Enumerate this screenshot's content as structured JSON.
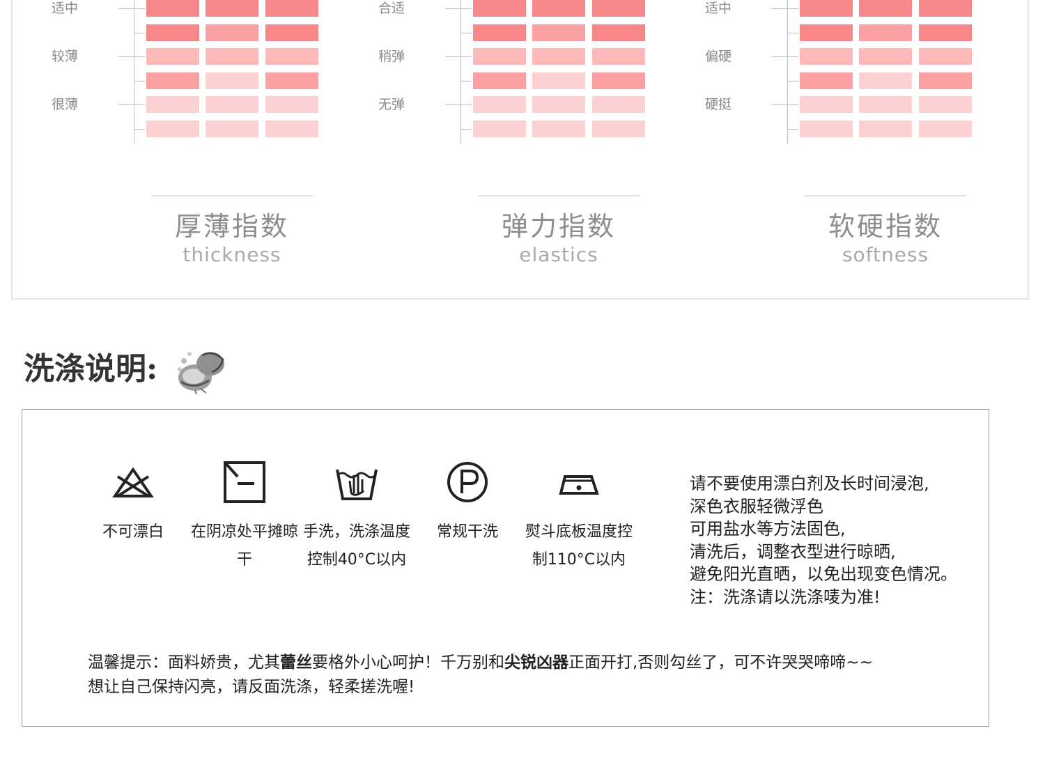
{
  "colors": {
    "level_strong": "#f88789",
    "level_mid": "#fba1a3",
    "level_light": "#fdb9ba",
    "level_pale": "#fdd1d2",
    "axis": "#bdbdbd"
  },
  "gauges": [
    {
      "title_cn": "厚薄指数",
      "title_en": "thickness",
      "labels": [
        "适中",
        "较薄",
        "很薄"
      ],
      "rows": [
        [
          "strong",
          "strong",
          "strong"
        ],
        [
          "strong",
          "mid",
          "strong"
        ],
        [
          "light",
          "light",
          "light"
        ],
        [
          "mid",
          "pale",
          "mid"
        ],
        [
          "pale",
          "pale",
          "pale"
        ],
        [
          "pale",
          "pale",
          "pale"
        ]
      ]
    },
    {
      "title_cn": "弹力指数",
      "title_en": "elastics",
      "labels": [
        "合适",
        "稍弹",
        "无弹"
      ],
      "rows": [
        [
          "strong",
          "strong",
          "strong"
        ],
        [
          "strong",
          "mid",
          "strong"
        ],
        [
          "light",
          "light",
          "light"
        ],
        [
          "mid",
          "pale",
          "mid"
        ],
        [
          "pale",
          "pale",
          "pale"
        ],
        [
          "pale",
          "pale",
          "pale"
        ]
      ]
    },
    {
      "title_cn": "软硬指数",
      "title_en": "softness",
      "labels": [
        "适中",
        "偏硬",
        "硬挺"
      ],
      "rows": [
        [
          "strong",
          "strong",
          "strong"
        ],
        [
          "strong",
          "mid",
          "strong"
        ],
        [
          "light",
          "light",
          "light"
        ],
        [
          "mid",
          "pale",
          "mid"
        ],
        [
          "pale",
          "pale",
          "pale"
        ],
        [
          "pale",
          "pale",
          "pale"
        ]
      ]
    }
  ],
  "wash": {
    "heading": "洗涤说明:",
    "icon": "washing-hands-icon",
    "care_items": [
      {
        "icon": "no-bleach-icon",
        "label": "不可漂白"
      },
      {
        "icon": "dry-flat-shade-icon",
        "label": "在阴凉处平摊晾干"
      },
      {
        "icon": "hand-wash-icon",
        "label": "手洗，洗涤温度控制40°C以内"
      },
      {
        "icon": "dry-clean-p-icon",
        "label": "常规干洗"
      },
      {
        "icon": "iron-icon",
        "label": "熨斗底板温度控制110°C以内"
      }
    ],
    "notes": [
      "请不要使用漂白剂及长时间浸泡,",
      "深色衣服轻微浮色",
      "可用盐水等方法固色,",
      "清洗后，调整衣型进行晾晒,",
      "避免阳光直晒，以免出现变色情况。",
      "注：洗涤请以洗涤唛为准!"
    ],
    "tips": {
      "line1_a": "温馨提示：面料娇贵，尤其",
      "line1_b": "蕾丝",
      "line1_c": "要格外小心呵护！千万别和",
      "line1_d": "尖锐凶器",
      "line1_e": "正面开打,否则勾丝了，可不许哭哭啼啼~~",
      "line2": "想让自己保持闪亮，请反面洗涤，轻柔搓洗喔!"
    }
  }
}
